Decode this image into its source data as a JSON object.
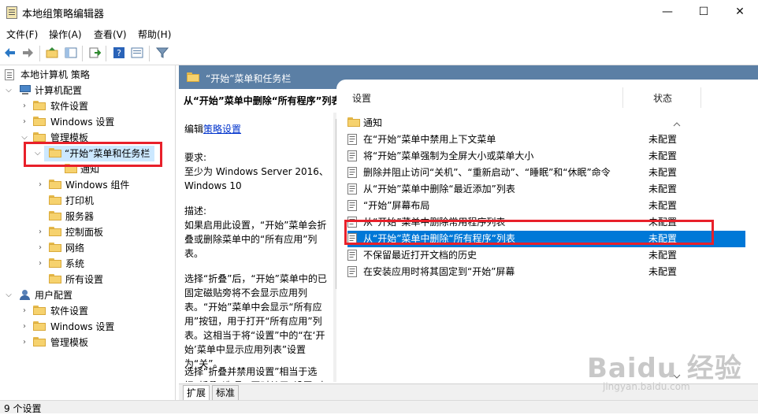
{
  "window": {
    "title": "本地组策略编辑器"
  },
  "window_controls": {
    "minimize": "—",
    "maximize": "☐",
    "close": "✕"
  },
  "menu": [
    "文件(F)",
    "操作(A)",
    "查看(V)",
    "帮助(H)"
  ],
  "tree": {
    "root": "本地计算机 策略",
    "computer_config": "计算机配置",
    "cc_children": [
      "软件设置",
      "Windows 设置",
      "管理模板"
    ],
    "admin_children": [
      "“开始”菜单和任务栏",
      "通知",
      "Windows 组件",
      "打印机",
      "服务器",
      "控制面板",
      "网络",
      "系统",
      "所有设置"
    ],
    "user_config": "用户配置",
    "uc_children": [
      "软件设置",
      "Windows 设置",
      "管理模板"
    ]
  },
  "header": {
    "title": "“开始”菜单和任务栏"
  },
  "description": {
    "title": "从“开始”菜单中删除“所有程序”列表",
    "edit_prefix": "编辑",
    "edit_link": "策略设置",
    "requirements_label": "要求:",
    "requirements": "至少为 Windows Server 2016、Windows 10",
    "desc_label": "描述:",
    "desc_p1": "如果启用此设置，“开始”菜单会折叠或删除菜单中的“所有应用”列表。",
    "desc_p2": "选择“折叠”后，“开始”菜单中的已固定磁贴旁将不会显示应用列表。“开始”菜单中会显示“所有应用”按钮，用于打开“所有应用”列表。这相当于将“设置”中的“在‘开始’菜单中显示应用列表”设置为“关”。",
    "desc_p3": "选择“折叠并禁用设置”相当于选择“折叠”选项，同时禁用“设置”中的"
  },
  "list": {
    "col_setting": "设置",
    "col_state": "状态",
    "rows": [
      {
        "name": "通知",
        "state": "",
        "kind": "folder"
      },
      {
        "name": "在“开始”菜单中禁用上下文菜单",
        "state": "未配置",
        "kind": "policy"
      },
      {
        "name": "将“开始”菜单强制为全屏大小或菜单大小",
        "state": "未配置",
        "kind": "policy"
      },
      {
        "name": "删除并阻止访问“关机”、“重新启动”、“睡眠”和“休眠”命令",
        "state": "未配置",
        "kind": "policy"
      },
      {
        "name": "从“开始”菜单中删除“最近添加”列表",
        "state": "未配置",
        "kind": "policy"
      },
      {
        "name": "“开始”屏幕布局",
        "state": "未配置",
        "kind": "policy"
      },
      {
        "name": "从“开始”菜单中删除常用程序列表",
        "state": "未配置",
        "kind": "policy"
      },
      {
        "name": "从“开始”菜单中删除“所有程序”列表",
        "state": "未配置",
        "kind": "policy",
        "selected": true
      },
      {
        "name": "不保留最近打开文档的历史",
        "state": "未配置",
        "kind": "policy"
      },
      {
        "name": "在安装应用时将其固定到“开始”屏幕",
        "state": "未配置",
        "kind": "policy"
      }
    ]
  },
  "tabs": [
    "扩展",
    "标准"
  ],
  "status": "9 个设置",
  "watermark": {
    "brand": "Baidu 经验",
    "url": "jingyan.baidu.com"
  },
  "colors": {
    "highlight": "#e8202a",
    "selection": "#0078d7",
    "header": "#5b7fa5"
  }
}
